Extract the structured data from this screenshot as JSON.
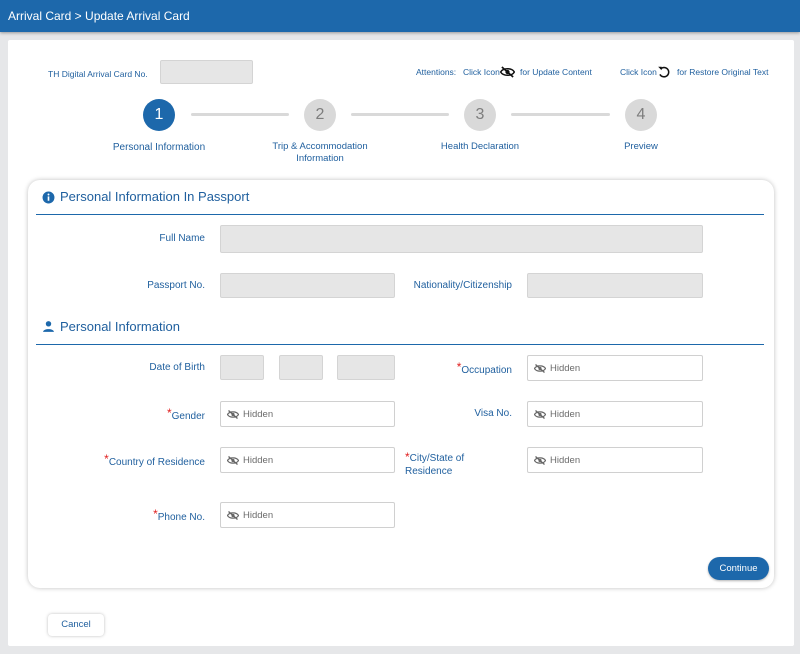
{
  "header": {
    "breadcrumb": "Arrival Card > Update Arrival Card"
  },
  "top": {
    "arrival_card_label": "TH Digital Arrival Card No.",
    "attention_label": "Attentions:",
    "click_icon_1": "Click Icon",
    "update_hint": "for Update Content",
    "click_icon_2": "Click Icon",
    "restore_hint": "for Restore Original Text"
  },
  "steps": [
    {
      "number": "1",
      "label_line1": "Personal Information",
      "label_line2": ""
    },
    {
      "number": "2",
      "label_line1": "Trip & Accommodation",
      "label_line2": "Information"
    },
    {
      "number": "3",
      "label_line1": "Health Declaration",
      "label_line2": ""
    },
    {
      "number": "4",
      "label_line1": "Preview",
      "label_line2": ""
    }
  ],
  "passport_section": {
    "title": "Personal Information In Passport",
    "full_name_label": "Full Name",
    "passport_no_label": "Passport No.",
    "nationality_label": "Nationality/Citizenship"
  },
  "personal_section": {
    "title": "Personal Information",
    "dob_label": "Date of Birth",
    "occupation_label": "Occupation",
    "gender_label": "Gender",
    "visa_label": "Visa No.",
    "country_label": "Country of Residence",
    "city_label_line1": "City/State of",
    "city_label_line2": "Residence",
    "phone_label": "Phone No.",
    "required_mark": "*",
    "hidden_text": "Hidden"
  },
  "buttons": {
    "continue": "Continue",
    "cancel": "Cancel"
  },
  "colors": {
    "brand": "#1d68ab",
    "required": "#e02020",
    "field_disabled": "#e6e6e6"
  }
}
